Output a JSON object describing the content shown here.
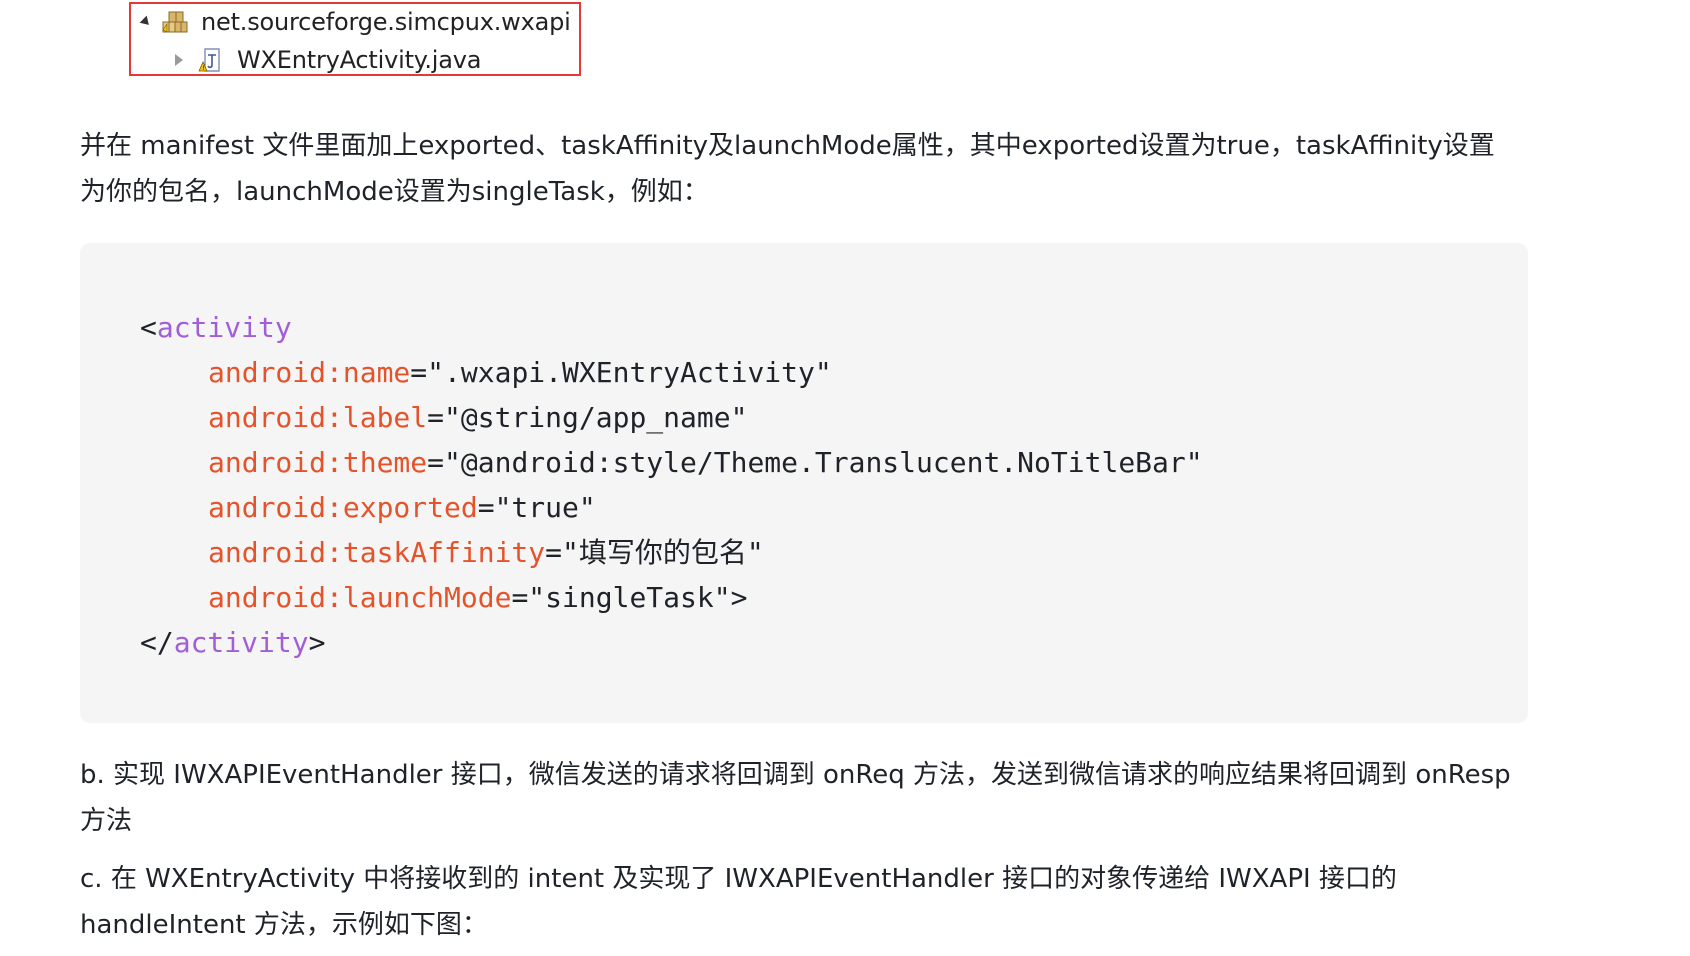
{
  "tree": {
    "package_name": "net.sourceforge.simcpux.wxapi",
    "file_name": "WXEntryActivity.java",
    "highlight_color": "#e53935"
  },
  "paragraph_1": "并在 manifest 文件里面加上exported、taskAffinity及launchMode属性，其中exported设置为true，taskAffinity设置为你的包名，launchMode设置为singleTask，例如：",
  "code": {
    "open_bracket": "<",
    "tag": "activity",
    "attributes": [
      {
        "name": "android:name",
        "value": "\".wxapi.WXEntryActivity\""
      },
      {
        "name": "android:label",
        "value": "\"@string/app_name\""
      },
      {
        "name": "android:theme",
        "value": "\"@android:style/Theme.Translucent.NoTitleBar\""
      },
      {
        "name": "android:exported",
        "value": "\"true\""
      },
      {
        "name": "android:taskAffinity",
        "value": "\"填写你的包名\""
      },
      {
        "name": "android:launchMode",
        "value": "\"singleTask\">"
      }
    ],
    "equals": "=",
    "close_open": "</",
    "close_tag": "activity",
    "close_end": ">",
    "colors": {
      "tag": "#a25ed8",
      "attribute": "#e5532b",
      "background": "#f5f5f5"
    }
  },
  "paragraph_b": "b. 实现 IWXAPIEventHandler 接口，微信发送的请求将回调到 onReq 方法，发送到微信请求的响应结果将回调到 onResp 方法",
  "paragraph_c": "c. 在 WXEntryActivity 中将接收到的 intent 及实现了 IWXAPIEventHandler 接口的对象传递给 IWXAPI 接口的 handleIntent 方法，示例如下图："
}
